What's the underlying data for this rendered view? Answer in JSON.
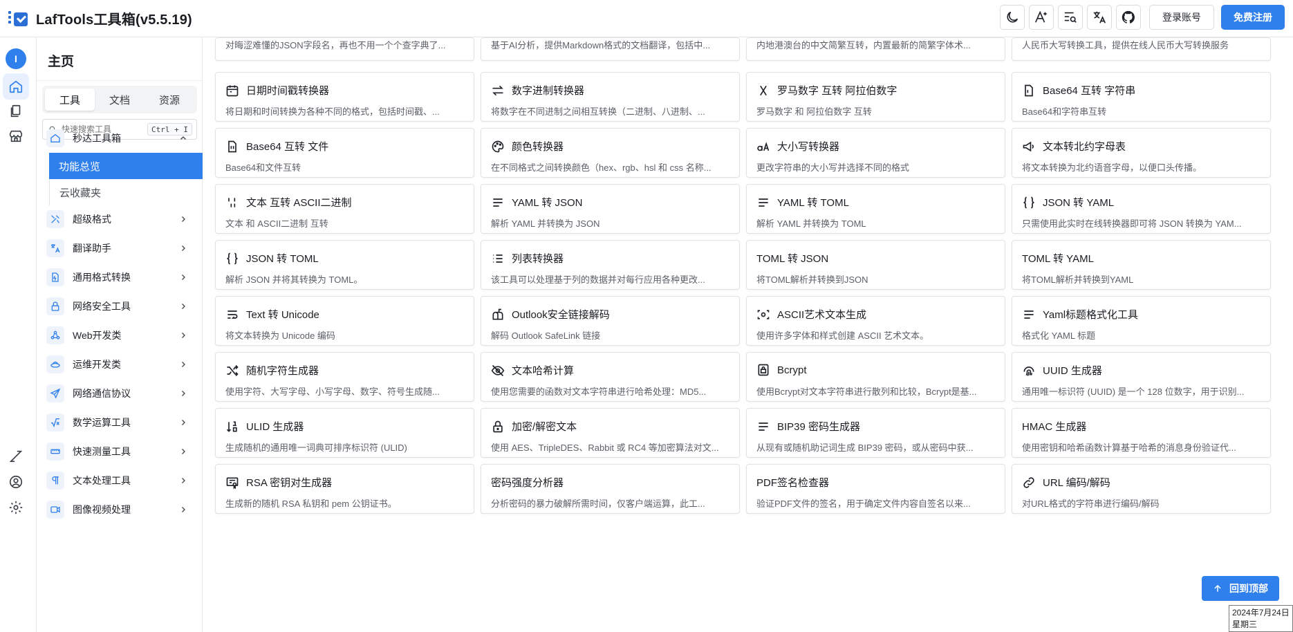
{
  "app": {
    "title": "LafTools工具箱(v5.5.19)"
  },
  "header": {
    "icons": [
      "moon-icon",
      "ai-icon",
      "search-list-icon",
      "translate-icon",
      "github-icon"
    ],
    "login_label": "登录账号",
    "register_label": "免费注册"
  },
  "rail": {
    "avatar_text": "I"
  },
  "sidebar": {
    "title": "主页",
    "tabs": [
      {
        "label": "工具",
        "active": true
      },
      {
        "label": "文档",
        "active": false
      },
      {
        "label": "资源",
        "active": false
      }
    ],
    "search": {
      "placeholder": "快速搜索工具",
      "shortcut": "Ctrl + I"
    },
    "groups": [
      {
        "label": "秒达工具箱",
        "expanded": true
      },
      {
        "label": "超级格式"
      },
      {
        "label": "翻译助手"
      },
      {
        "label": "通用格式转换"
      },
      {
        "label": "网络安全工具"
      },
      {
        "label": "Web开发类"
      },
      {
        "label": "运维开发类"
      },
      {
        "label": "网络通信协议"
      },
      {
        "label": "数学运算工具"
      },
      {
        "label": "快速测量工具"
      },
      {
        "label": "文本处理工具"
      },
      {
        "label": "图像视频处理"
      }
    ],
    "sub_items": [
      {
        "label": "功能总览",
        "active": true
      },
      {
        "label": "云收藏夹",
        "active": false
      }
    ]
  },
  "main": {
    "top_cut": [
      "对晦涩难懂的JSON字段名，再也不用一个个查字典了...",
      "基于AI分析，提供Markdown格式的文档翻译，包括中...",
      "内地港澳台的中文简繁互转，内置最新的简繁字体术...",
      "人民币大写转换工具，提供在线人民币大写转换服务"
    ],
    "cards": [
      {
        "title": "日期时间戳转换器",
        "desc": "将日期和时间转换为各种不同的格式，包括时间戳、...",
        "icon": "calendar-icon"
      },
      {
        "title": "数字进制转换器",
        "desc": "将数字在不同进制之间相互转换（二进制、八进制、...",
        "icon": "arrows-swap-icon"
      },
      {
        "title": "罗马数字 互转 阿拉伯数字",
        "desc": "罗马数字 和 阿拉伯数字 互转",
        "icon": "x-letter-icon"
      },
      {
        "title": "Base64 互转 字符串",
        "desc": "Base64和字符串互转",
        "icon": "file-binary-icon"
      },
      {
        "title": "Base64 互转 文件",
        "desc": "Base64和文件互转",
        "icon": "file-binary-icon"
      },
      {
        "title": "颜色转换器",
        "desc": "在不同格式之间转换颜色（hex、rgb、hsl 和 css 名称...",
        "icon": "palette-icon"
      },
      {
        "title": "大小写转换器",
        "desc": "更改字符串的大小写并选择不同的格式",
        "icon": "letter-case-icon"
      },
      {
        "title": "文本转北约字母表",
        "desc": "将文本转换为北约语音字母，以便口头传播。",
        "icon": "megaphone-icon"
      },
      {
        "title": "文本 互转 ASCII二进制",
        "desc": "文本 和 ASCII二进制 互转",
        "icon": "binary-icon"
      },
      {
        "title": "YAML 转 JSON",
        "desc": "解析 YAML 并转换为 JSON",
        "icon": "lines-icon"
      },
      {
        "title": "YAML 转 TOML",
        "desc": "解析 YAML 并转换为 TOML",
        "icon": "lines-icon"
      },
      {
        "title": "JSON 转 YAML",
        "desc": "只需使用此实时在线转换器即可将 JSON 转换为 YAM...",
        "icon": "braces-icon"
      },
      {
        "title": "JSON 转 TOML",
        "desc": "解析 JSON 并将其转换为 TOML。",
        "icon": "braces-icon"
      },
      {
        "title": "列表转换器",
        "desc": "该工具可以处理基于列的数据并对每行应用各种更改...",
        "icon": "list-icon"
      },
      {
        "title": "TOML 转 JSON",
        "desc": "将TOML解析并转换到JSON",
        "icon": ""
      },
      {
        "title": "TOML 转 YAML",
        "desc": "将TOML解析并转换到YAML",
        "icon": ""
      },
      {
        "title": "Text 转 Unicode",
        "desc": "将文本转换为 Unicode 编码",
        "icon": "text-wrap-icon"
      },
      {
        "title": "Outlook安全链接解码",
        "desc": "解码 Outlook SafeLink 链接",
        "icon": "mailbox-icon"
      },
      {
        "title": "ASCII艺术文本生成",
        "desc": "使用许多字体和样式创建 ASCII 艺术文本。",
        "icon": "focus-icon"
      },
      {
        "title": "Yaml标题格式化工具",
        "desc": "格式化 YAML 标题",
        "icon": "lines-icon"
      },
      {
        "title": "随机字符生成器",
        "desc": "使用字符、大写字母、小写字母、数字、符号生成随...",
        "icon": "shuffle-icon"
      },
      {
        "title": "文本哈希计算",
        "desc": "使用您需要的函数对文本字符串进行哈希处理：MD5...",
        "icon": "eye-off-icon"
      },
      {
        "title": "Bcrypt",
        "desc": "使用Bcrypt对文本字符串进行散列和比较，Bcrypt是基...",
        "icon": "lock-box-icon"
      },
      {
        "title": "UUID 生成器",
        "desc": "通用唯一标识符 (UUID) 是一个 128 位数字，用于识别...",
        "icon": "fingerprint-icon"
      },
      {
        "title": "ULID 生成器",
        "desc": "生成随机的通用唯一词典可排序标识符 (ULID)",
        "icon": "sort-numeric-icon"
      },
      {
        "title": "加密/解密文本",
        "desc": "使用 AES、TripleDES、Rabbit 或 RC4 等加密算法对文...",
        "icon": "lock-icon"
      },
      {
        "title": "BIP39 密码生成器",
        "desc": "从现有或随机助记词生成 BIP39 密码，或从密码中获...",
        "icon": "lines-icon"
      },
      {
        "title": "HMAC 生成器",
        "desc": "使用密钥和哈希函数计算基于哈希的消息身份验证代...",
        "icon": ""
      },
      {
        "title": "RSA 密钥对生成器",
        "desc": "生成新的随机 RSA 私钥和 pem 公钥证书。",
        "icon": "certificate-icon"
      },
      {
        "title": "密码强度分析器",
        "desc": "分析密码的暴力破解所需时间，仅客户端运算，此工...",
        "icon": ""
      },
      {
        "title": "PDF签名检查器",
        "desc": "验证PDF文件的签名，用于确定文件内容自签名以来...",
        "icon": ""
      },
      {
        "title": "URL 编码/解码",
        "desc": "对URL格式的字符串进行编码/解码",
        "icon": "link-icon"
      }
    ]
  },
  "back_to_top": {
    "label": "回到顶部"
  },
  "system_date": {
    "line1": "2024年7月24日",
    "line2": "星期三"
  },
  "colors": {
    "accent": "#2f80ed",
    "border": "#dfe2e6",
    "text": "#1f2328"
  }
}
